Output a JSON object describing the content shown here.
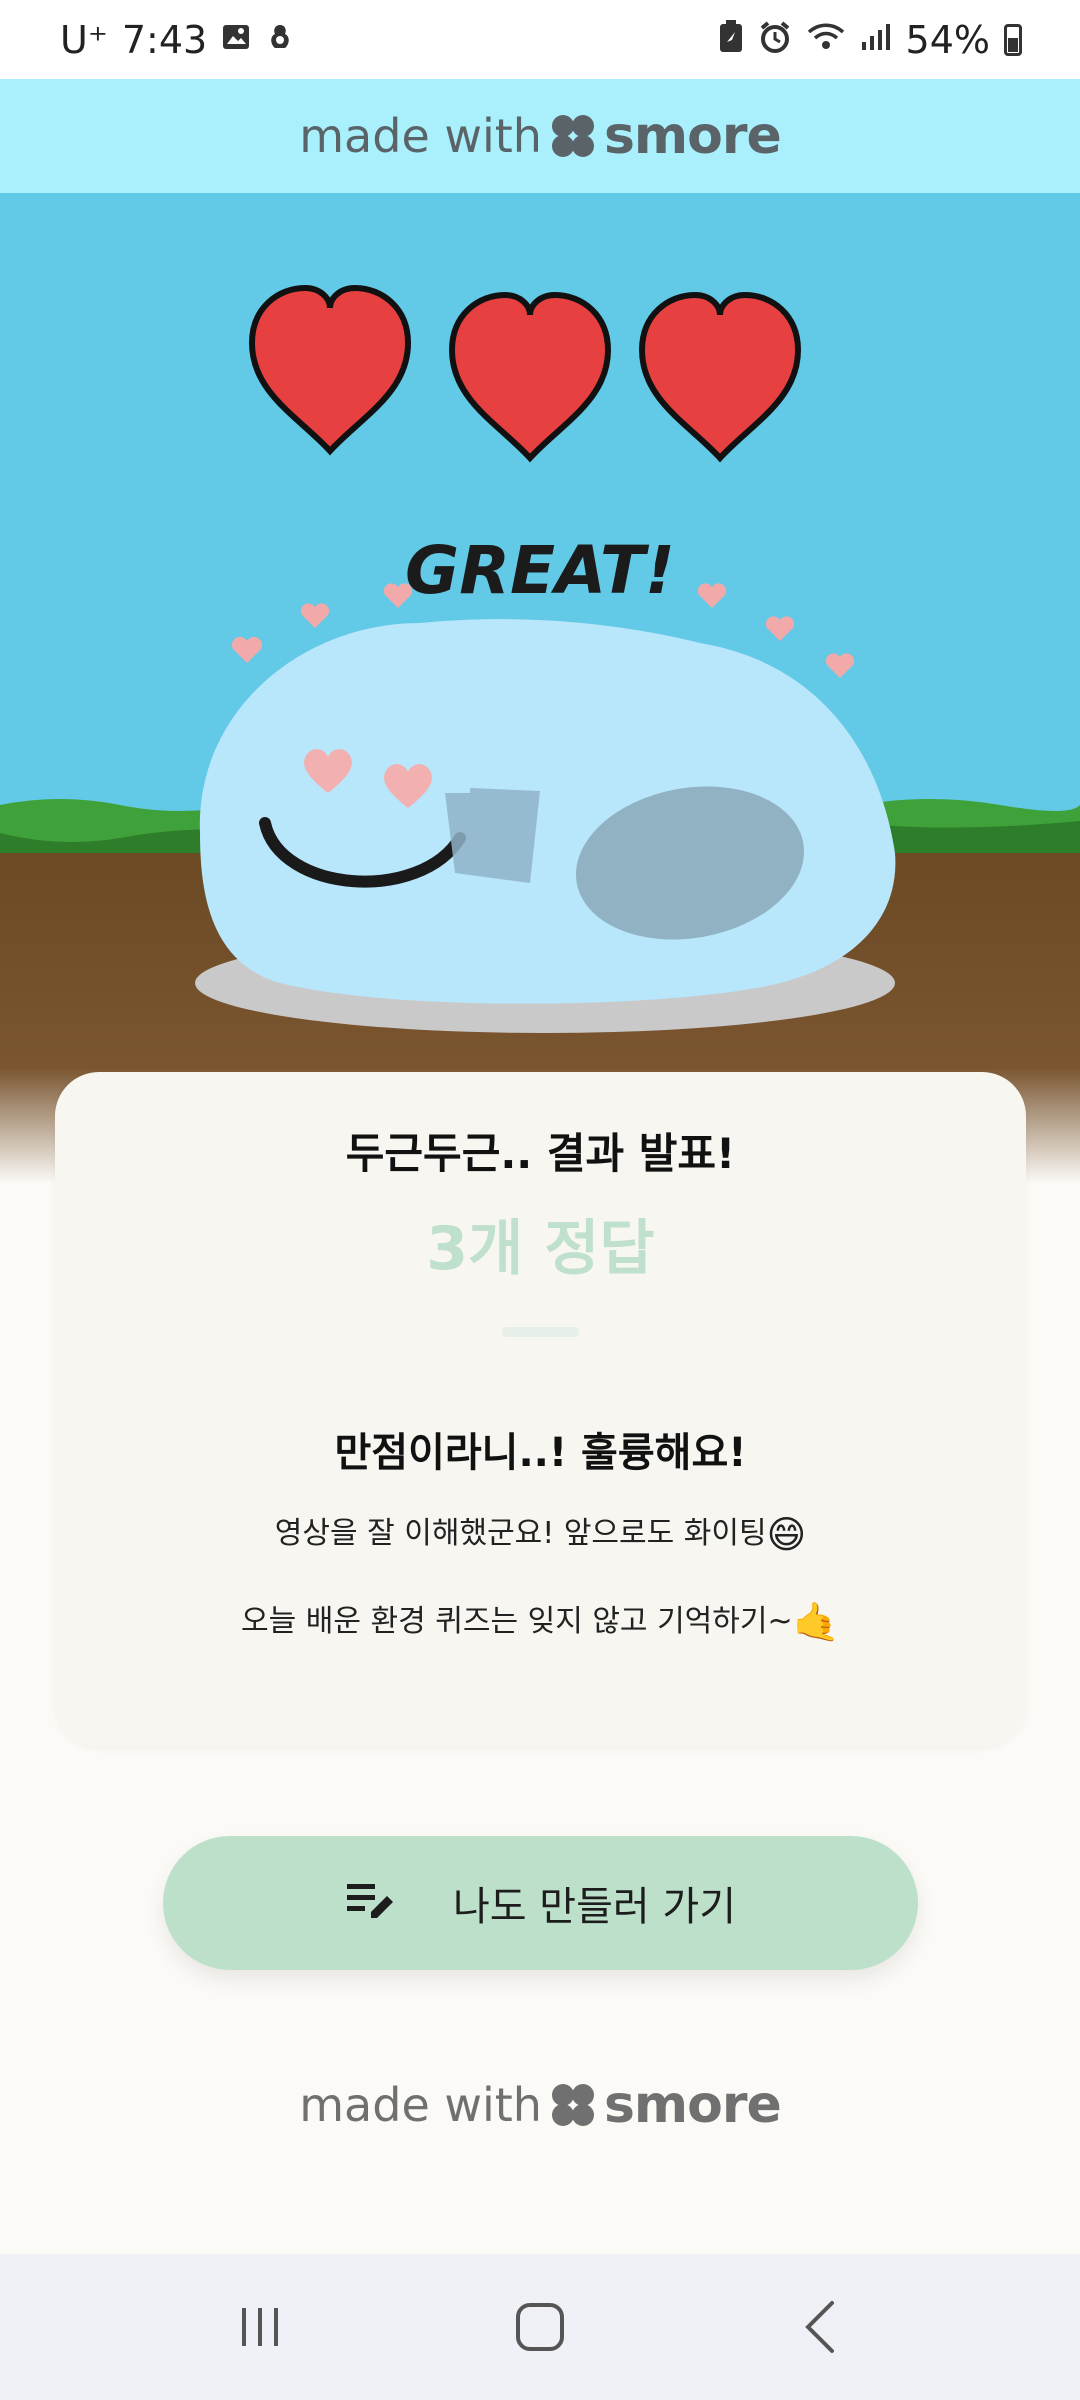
{
  "status_bar": {
    "carrier": "U⁺",
    "time": "7:43",
    "battery_percent": "54%",
    "icons_left": [
      "image-icon",
      "app-notification-icon"
    ],
    "icons_right": [
      "battery-saver-icon",
      "alarm-icon",
      "wifi-icon",
      "signal-icon",
      "battery-icon"
    ]
  },
  "banner": {
    "made_with": "made with",
    "brand": "smore"
  },
  "hero": {
    "caption": "GREAT!",
    "hearts_count": 3
  },
  "result": {
    "heading": "두근두근.. 결과 발표!",
    "score": "3개 정답",
    "title": "만점이라니..! 훌륭해요!",
    "line1": "영상을 잘 이해했군요! 앞으로도 화이팅",
    "line1_emoji": "😄",
    "line2": "오늘 배운 환경 퀴즈는 잊지 않고 기억하기~",
    "line2_emoji": "🤙"
  },
  "cta": {
    "label": "나도 만들러 가기",
    "icon": "edit-note-icon"
  },
  "footer": {
    "made_with": "made with",
    "brand": "smore"
  },
  "nav": {
    "recent": "recent-apps-icon",
    "home": "home-icon",
    "back": "back-icon"
  },
  "colors": {
    "banner_bg": "#aaf0fc",
    "sky": "#62c9e6",
    "score_color": "#bfe0cd",
    "cta_bg": "#bde0ca"
  }
}
